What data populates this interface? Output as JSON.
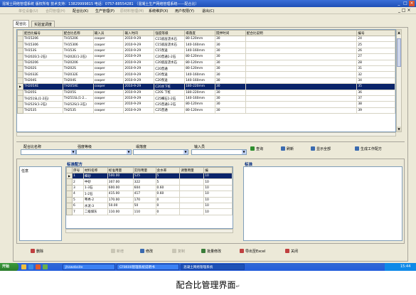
{
  "window": {
    "title": "混凝土网络管理系统  版权所有  技术支持：13829999815  电话：0757-88554281  （混凝土生产网络管理系统——配合比）",
    "min": "_",
    "max": "□",
    "close": "×"
  },
  "menu": [
    {
      "label": "单位设备(U)",
      "color": "#9a9a9a"
    },
    {
      "label": "合同管理(H)",
      "color": "#9a9a9a"
    },
    {
      "label": "配合比(K)",
      "color": "#c04040"
    },
    {
      "label": "生产管理(P)",
      "color": "#3a7d3a"
    },
    {
      "label": "原材料管理(M)",
      "color": "#9a9a9a"
    },
    {
      "label": "系统维护(X)",
      "color": "#3a6ab0"
    },
    {
      "label": "用户权限(Y)",
      "color": "#3a6ab0"
    },
    {
      "label": "退出(C)",
      "color": "#c04040"
    }
  ],
  "mdi_controls": "_ □ ×",
  "tabs": [
    "配合比",
    "实验室调度"
  ],
  "top_grid": {
    "columns": [
      "配合比编号",
      "配合比名称",
      "输入员",
      "输入时间",
      "强度等级",
      "塌落度",
      "搅拌时间",
      "配合比说明",
      "编号"
    ],
    "rows": [
      [
        "TH15206",
        "TH15206",
        "cooper",
        "2010-9-29",
        "C15底层浇水石",
        "80-120mm",
        "30",
        "",
        "24"
      ],
      [
        "TH15306",
        "TH15306",
        "cooper",
        "2010-9-29",
        "C15底层浇水石",
        "140-160mm",
        "30",
        "",
        "25"
      ],
      [
        "TH153S",
        "TH153S",
        "cooper",
        "2010-9-29",
        "C15泵送",
        "140-160mm",
        "30",
        "",
        "26"
      ],
      [
        "TH202E(1-2石)",
        "TH202E(1-2石)",
        "cooper",
        "2010-9-29",
        "C20普通1-2石",
        "80-120mm",
        "30",
        "",
        "27"
      ],
      [
        "TH20206",
        "TH20206",
        "cooper",
        "2010-9-29",
        "C20底层浇水石",
        "80-120mm",
        "30",
        "",
        "28"
      ],
      [
        "TH202S",
        "TH202S",
        "cooper",
        "2010-9-29",
        "C20普通",
        "80-120mm",
        "30",
        "",
        "31"
      ],
      [
        "TH2032E",
        "TH2032E",
        "cooper",
        "2010-9-29",
        "C20泵送",
        "140-160mm",
        "30",
        "",
        "32"
      ],
      [
        "TH204S",
        "TH204S",
        "cooper",
        "2010-9-29",
        "C20泵送",
        "140-160mm",
        "30",
        "",
        "34"
      ],
      [
        "TH205XE",
        "TH205XE",
        "cooper",
        "2010-9-29",
        "C20水下桩",
        "180-220mm",
        "30",
        "",
        "35"
      ],
      [
        "TH205S",
        "TH205S",
        "cooper",
        "2010-9-29",
        "C20S 下桩",
        "180-220mm",
        "30",
        "",
        "36"
      ],
      [
        "TH251SL(1-2石)",
        "TH251SL(1-2...",
        "cooper",
        "2010-9-29",
        "C25细石1-2石",
        "140-160mm",
        "30",
        "",
        "37"
      ],
      [
        "TH252S(1-2石)",
        "TH252S(1-2石)",
        "cooper",
        "2010-9-29",
        "C25普通1-2石",
        "80-120mm",
        "30",
        "",
        "38"
      ],
      [
        "TH2535",
        "TH2535",
        "cooper",
        "2010-9-29",
        "C25普通",
        "80-120mm",
        "30",
        "",
        "39"
      ]
    ],
    "selected_index": 8
  },
  "filters": [
    {
      "label": "配合比名称"
    },
    {
      "label": "强度等级"
    },
    {
      "label": "塌落度"
    },
    {
      "label": "输入员"
    }
  ],
  "filter_buttons": [
    {
      "label": "查询",
      "color": "#2f8f2f"
    },
    {
      "label": "刷新",
      "color": "#3a6ab0"
    },
    {
      "label": "显示全部",
      "color": "#3a6ab0"
    },
    {
      "label": "生成工作配方",
      "color": "#3a6ab0"
    }
  ],
  "sequence_list": {
    "items": [
      "任意"
    ]
  },
  "std_mix": {
    "title": "标准配方",
    "columns": [
      "序号",
      "材料名称",
      "标准用量",
      "实际用量",
      "含水率",
      "调整用量",
      "编"
    ],
    "rows": [
      [
        "1",
        "细砂",
        "500.00",
        "525",
        "5",
        "",
        "10"
      ],
      [
        "2",
        "中砂",
        "307.00",
        "322",
        "5",
        "",
        "10"
      ],
      [
        "3",
        "1-3石",
        "600.00",
        "604",
        "0.60",
        "",
        "10"
      ],
      [
        "4",
        "1-2石",
        "415.00",
        "417",
        "0.60",
        "",
        "10"
      ],
      [
        "5",
        "粤秀-2",
        "170.00",
        "170",
        "0",
        "",
        "10"
      ],
      [
        "6",
        "水泥-3",
        "50.00",
        "50",
        "0",
        "",
        "10"
      ],
      [
        "7",
        "二级煤灰",
        "110.00",
        "110",
        "0",
        "",
        "10"
      ]
    ],
    "selected_index": 0
  },
  "standard_panel_title": "标准",
  "actions": [
    {
      "label": "删除",
      "color": "#c04040",
      "enabled": true
    },
    {
      "label": "新增",
      "color": "#9a978a",
      "enabled": false
    },
    {
      "label": "修改",
      "color": "#3a6ab0",
      "enabled": true
    },
    {
      "label": "复制",
      "color": "#9a978a",
      "enabled": false
    },
    {
      "label": "批量修改",
      "color": "#3a7d3a",
      "enabled": true
    },
    {
      "label": "导出至Excel",
      "color": "#c04040",
      "enabled": true
    },
    {
      "label": "关闭",
      "color": "#c04040",
      "enabled": true
    }
  ],
  "taskbar": {
    "start": "开始",
    "tasks": [
      {
        "label": "jhzwebsite",
        "active": false
      },
      {
        "label": "CF8600管理系统说明书",
        "active": false
      },
      {
        "label": "混凝土网络管理系统",
        "active": true
      }
    ],
    "clock": "15:44"
  },
  "caption": "配合比管理界面"
}
